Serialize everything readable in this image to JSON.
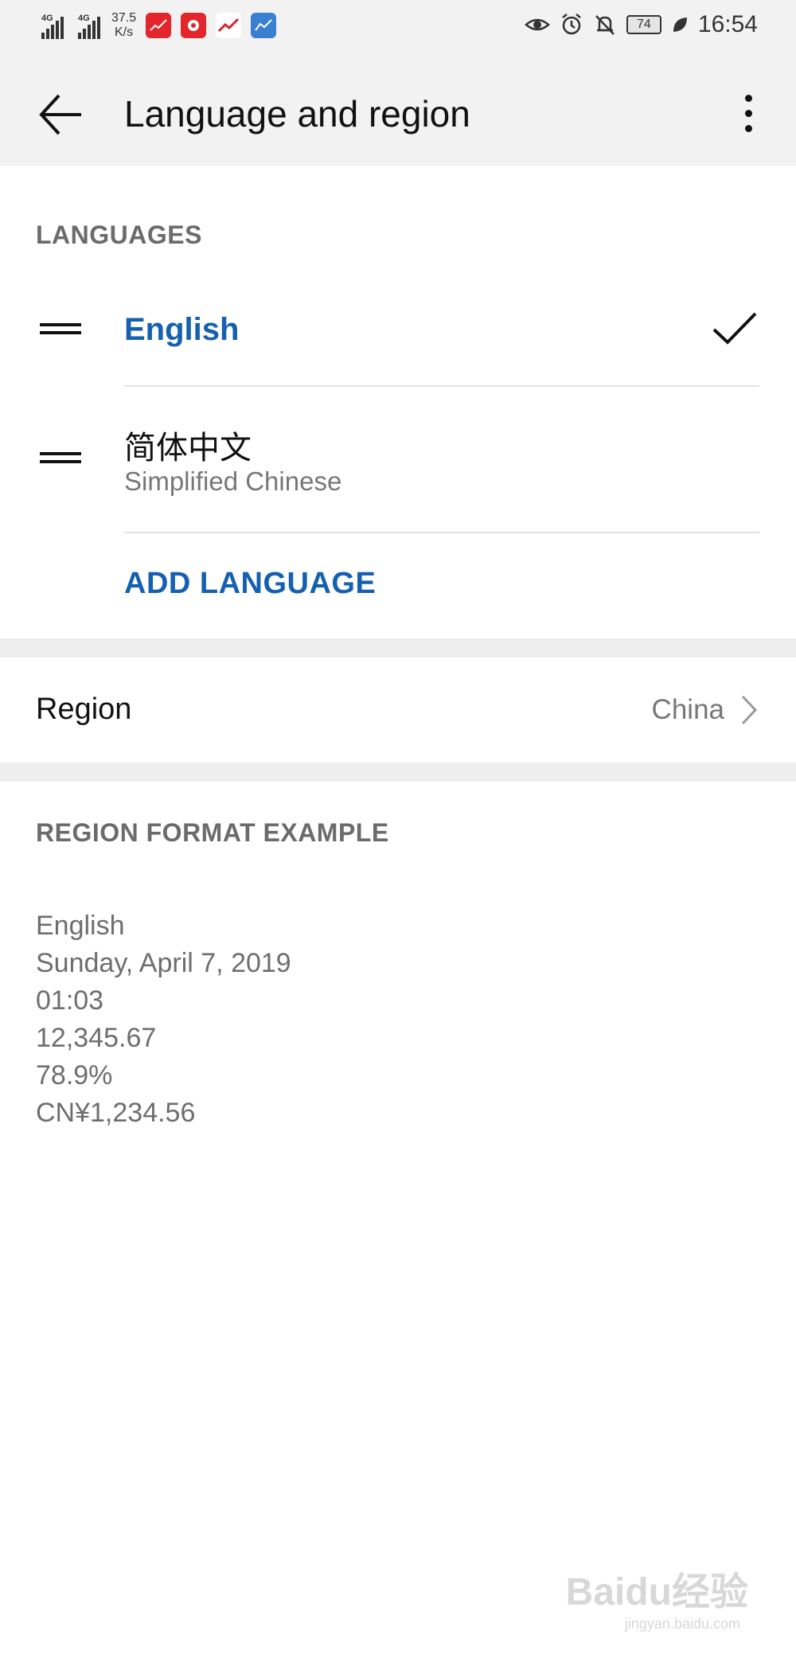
{
  "status_bar": {
    "signal1_label": "4G",
    "signal2_label": "4G",
    "speed_value": "37.5",
    "speed_unit": "K/s",
    "battery": "74",
    "time": "16:54",
    "icons": [
      "signal-icon",
      "signal-icon",
      "app-icon",
      "app-icon",
      "app-icon",
      "app-icon",
      "eye-icon",
      "alarm-icon",
      "bell-off-icon",
      "battery-icon",
      "leaf-icon"
    ]
  },
  "app_bar": {
    "title": "Language and region",
    "back_icon": "arrow-left-icon",
    "menu_icon": "more-vert-icon"
  },
  "languages": {
    "header": "LANGUAGES",
    "items": [
      {
        "name": "English",
        "selected": true
      },
      {
        "name": "简体中文",
        "subtitle": "Simplified Chinese",
        "selected": false
      }
    ],
    "add_label": "ADD LANGUAGE"
  },
  "region": {
    "label": "Region",
    "value": "China"
  },
  "format_example": {
    "header": "REGION FORMAT EXAMPLE",
    "lines": [
      "English",
      "Sunday, April 7, 2019",
      "01:03",
      "12,345.67",
      "78.9%",
      "CN¥1,234.56"
    ]
  },
  "watermark": {
    "text": "Baidu经验",
    "sub": "jingyan.baidu.com"
  },
  "colors": {
    "accent": "#1560b0",
    "header_bg": "#f2f2f2",
    "section_gap": "#eeeeee"
  }
}
